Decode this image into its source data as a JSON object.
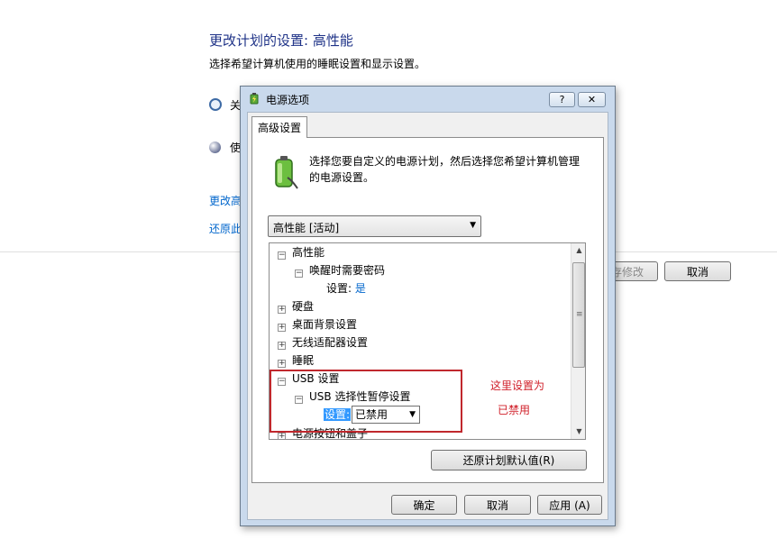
{
  "background": {
    "title": "更改计划的设置: 高性能",
    "subtitle": "选择希望计算机使用的睡眠设置和显示设置。",
    "rows": [
      "关",
      "使"
    ],
    "links": [
      "更改高",
      "还原此"
    ],
    "save_button": "保存修改",
    "cancel_button": "取消"
  },
  "dialog": {
    "title": "电源选项",
    "help_button": "?",
    "close_button": "✕",
    "tab": "高级设置",
    "description": "选择您要自定义的电源计划，然后选择您希望计算机管理的电源设置。",
    "plan_select": "高性能 [活动]",
    "tree": {
      "plan": "高性能",
      "password_on_wake": "唤醒时需要密码",
      "setting_label": "设置:",
      "password_value": "是",
      "hard_disk": "硬盘",
      "desktop_background": "桌面背景设置",
      "wireless_adapter": "无线适配器设置",
      "sleep": "睡眠",
      "usb_settings": "USB 设置",
      "usb_selective_suspend": "USB 选择性暂停设置",
      "usb_setting_label": "设置:",
      "usb_value": "已禁用",
      "power_buttons": "电源按钮和盖子"
    },
    "restore_defaults_button": "还原计划默认值(R)",
    "ok_button": "确定",
    "cancel_button": "取消",
    "apply_button": "应用 (A)"
  },
  "annotation": {
    "line1": "这里设置为",
    "line2": "已禁用",
    "color": "#c0282d"
  }
}
